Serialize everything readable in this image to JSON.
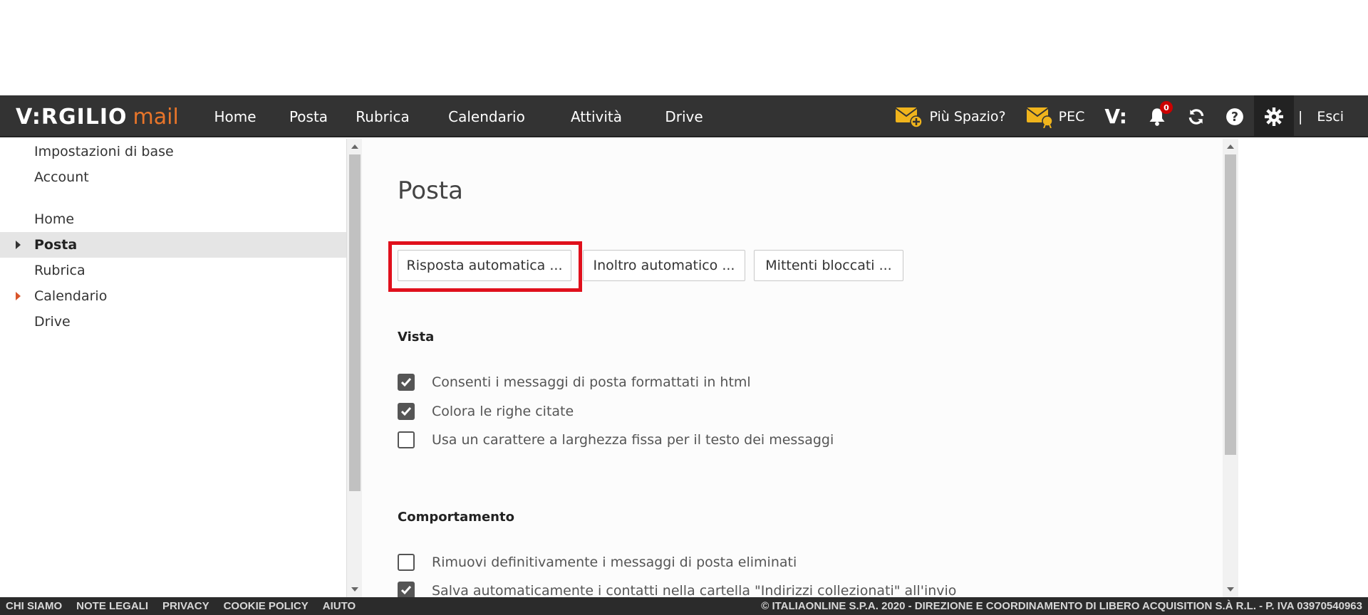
{
  "brand": {
    "logo_main": "V:RGILIO",
    "logo_sub": "mail"
  },
  "nav": [
    "Home",
    "Posta",
    "Rubrica",
    "Calendario",
    "Attività",
    "Drive"
  ],
  "tools": {
    "more_space": "Più Spazio?",
    "pec": "PEC",
    "v_label": "V:",
    "notifications_count": "0",
    "separator": "|",
    "logout": "Esci"
  },
  "sidebar": {
    "items": [
      "Impostazioni di base",
      "Account",
      "Home",
      "Posta",
      "Rubrica",
      "Calendario",
      "Drive"
    ],
    "active": "Posta"
  },
  "main": {
    "title": "Posta",
    "buttons": [
      "Risposta automatica ...",
      "Inoltro automatico ...",
      "Mittenti bloccati ..."
    ],
    "vista_title": "Vista",
    "vista_options": [
      {
        "label": "Consenti i messaggi di posta formattati in html",
        "checked": true
      },
      {
        "label": "Colora le righe citate",
        "checked": true
      },
      {
        "label": "Usa un carattere a larghezza fissa per il testo dei messaggi",
        "checked": false
      }
    ],
    "comportamento_title": "Comportamento",
    "comportamento_options": [
      {
        "label": "Rimuovi definitivamente i messaggi di posta eliminati",
        "checked": false
      },
      {
        "label": "Salva automaticamente i contatti nella cartella \"Indirizzi collezionati\" all'invio",
        "checked": true
      }
    ]
  },
  "footer": {
    "links": [
      "CHI SIAMO",
      "NOTE LEGALI",
      "PRIVACY",
      "COOKIE POLICY",
      "AIUTO"
    ],
    "copyright": "© ITALIAONLINE S.P.A. 2020 - DIREZIONE E COORDINAMENTO DI LIBERO ACQUISITION S.À R.L. - P. IVA 03970540963"
  },
  "colors": {
    "accent_logo": "#e8752a",
    "highlight": "#e0101c",
    "envelope": "#f0b41c",
    "badge": "#cc0000"
  }
}
